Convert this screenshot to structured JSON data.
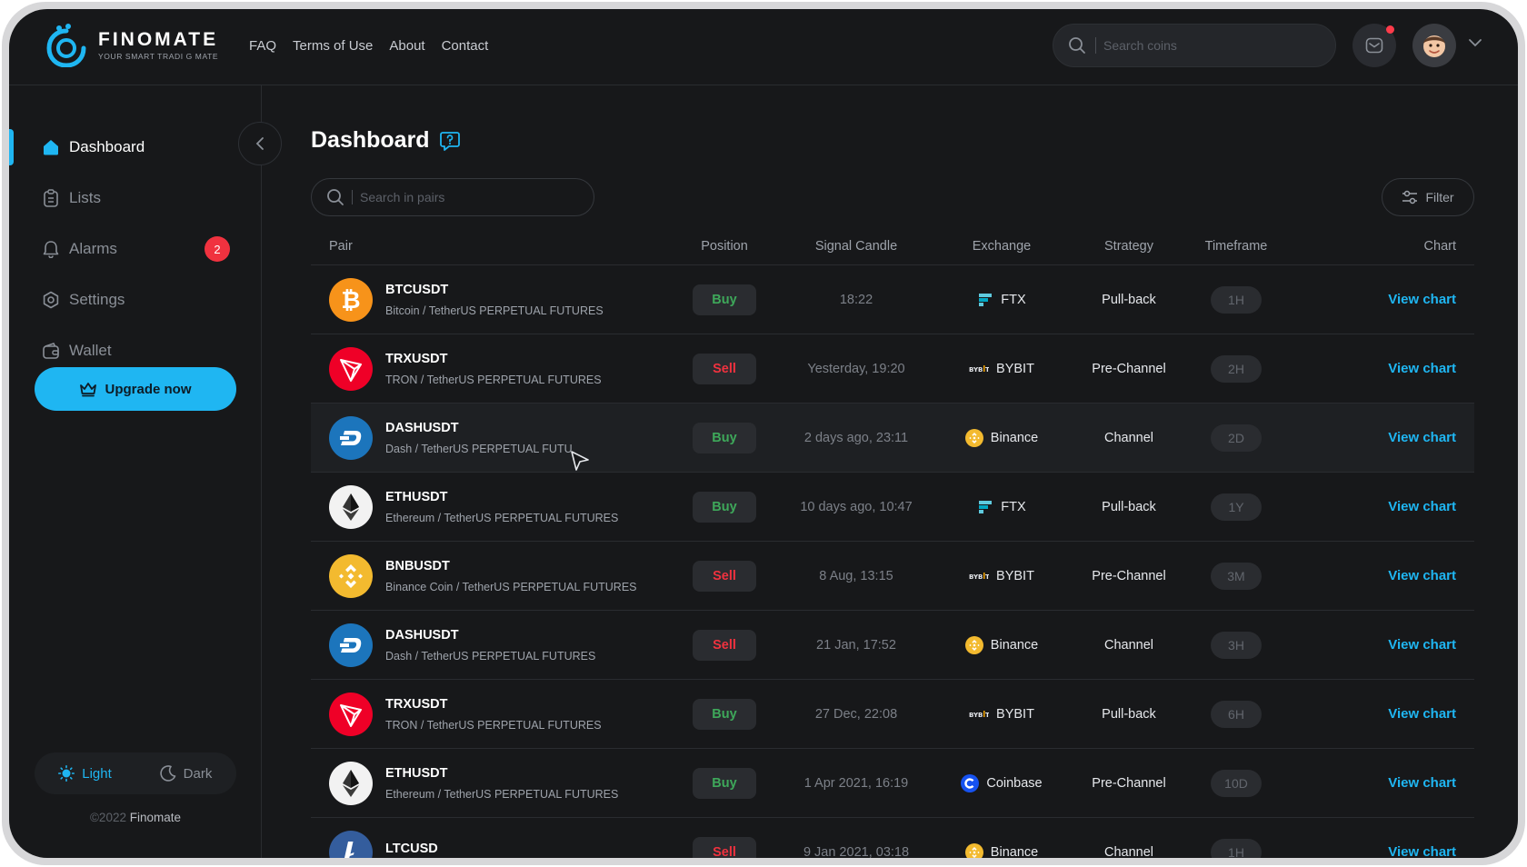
{
  "brand": {
    "name": "FINOMATE",
    "tagline": "YOUR SMART TRADI  G MATE"
  },
  "nav": [
    "FAQ",
    "Terms of Use",
    "About",
    "Contact"
  ],
  "top_search": {
    "placeholder": "Search coins"
  },
  "sidebar": {
    "items": [
      {
        "label": "Dashboard",
        "icon": "home-icon",
        "active": true
      },
      {
        "label": "Lists",
        "icon": "clipboard-icon"
      },
      {
        "label": "Alarms",
        "icon": "bell-icon",
        "badge": "2"
      },
      {
        "label": "Settings",
        "icon": "gear-icon"
      },
      {
        "label": "Wallet",
        "icon": "wallet-icon"
      }
    ],
    "upgrade_label": "Upgrade now",
    "theme": {
      "light": "Light",
      "dark": "Dark"
    },
    "copyright_prefix": "©2022",
    "copyright_brand": "Finomate"
  },
  "main": {
    "title": "Dashboard",
    "search_placeholder": "Search in pairs",
    "filter_label": "Filter",
    "columns": {
      "pair": "Pair",
      "position": "Position",
      "signal": "Signal Candle",
      "exchange": "Exchange",
      "strategy": "Strategy",
      "timeframe": "Timeframe",
      "chart": "Chart"
    },
    "rows": [
      {
        "symbol": "BTCUSDT",
        "name": "Bitcoin / TetherUS PERPETUAL FUTURES",
        "coin": "bitcoin",
        "position": "Buy",
        "signal": "18:22",
        "exchange": "FTX",
        "strategy": "Pull-back",
        "timeframe": "1H",
        "chart": "View chart"
      },
      {
        "symbol": "TRXUSDT",
        "name": "TRON / TetherUS PERPETUAL FUTURES",
        "coin": "tron",
        "position": "Sell",
        "signal": "Yesterday, 19:20",
        "exchange": "BYBIT",
        "strategy": "Pre-Channel",
        "timeframe": "2H",
        "chart": "View chart"
      },
      {
        "symbol": "DASHUSDT",
        "name": "Dash / TetherUS PERPETUAL FUTU",
        "coin": "dash",
        "position": "Buy",
        "signal": "2 days ago, 23:11",
        "exchange": "Binance",
        "strategy": "Channel",
        "timeframe": "2D",
        "chart": "View chart"
      },
      {
        "symbol": "ETHUSDT",
        "name": "Ethereum / TetherUS PERPETUAL FUTURES",
        "coin": "ethereum",
        "position": "Buy",
        "signal": "10 days ago, 10:47",
        "exchange": "FTX",
        "strategy": "Pull-back",
        "timeframe": "1Y",
        "chart": "View chart"
      },
      {
        "symbol": "BNBUSDT",
        "name": "Binance Coin / TetherUS PERPETUAL FUTURES",
        "coin": "bnb",
        "position": "Sell",
        "signal": "8 Aug, 13:15",
        "exchange": "BYBIT",
        "strategy": "Pre-Channel",
        "timeframe": "3M",
        "chart": "View chart"
      },
      {
        "symbol": "DASHUSDT",
        "name": "Dash / TetherUS PERPETUAL FUTURES",
        "coin": "dash",
        "position": "Sell",
        "signal": "21 Jan, 17:52",
        "exchange": "Binance",
        "strategy": "Channel",
        "timeframe": "3H",
        "chart": "View chart"
      },
      {
        "symbol": "TRXUSDT",
        "name": "TRON / TetherUS PERPETUAL FUTURES",
        "coin": "tron",
        "position": "Buy",
        "signal": "27 Dec, 22:08",
        "exchange": "BYBIT",
        "strategy": "Pull-back",
        "timeframe": "6H",
        "chart": "View chart"
      },
      {
        "symbol": "ETHUSDT",
        "name": "Ethereum / TetherUS PERPETUAL FUTURES",
        "coin": "ethereum",
        "position": "Buy",
        "signal": "1 Apr 2021, 16:19",
        "exchange": "Coinbase",
        "strategy": "Pre-Channel",
        "timeframe": "10D",
        "chart": "View chart"
      },
      {
        "symbol": "LTCUSD",
        "name": "",
        "coin": "litecoin",
        "position": "Sell",
        "signal": "9 Jan 2021, 03:18",
        "exchange": "Binance",
        "strategy": "Channel",
        "timeframe": "1H",
        "chart": "View chart"
      }
    ]
  },
  "colors": {
    "accent": "#1fb6f2",
    "buy": "#3ea85a",
    "sell": "#f0323f",
    "background": "#17181a"
  }
}
